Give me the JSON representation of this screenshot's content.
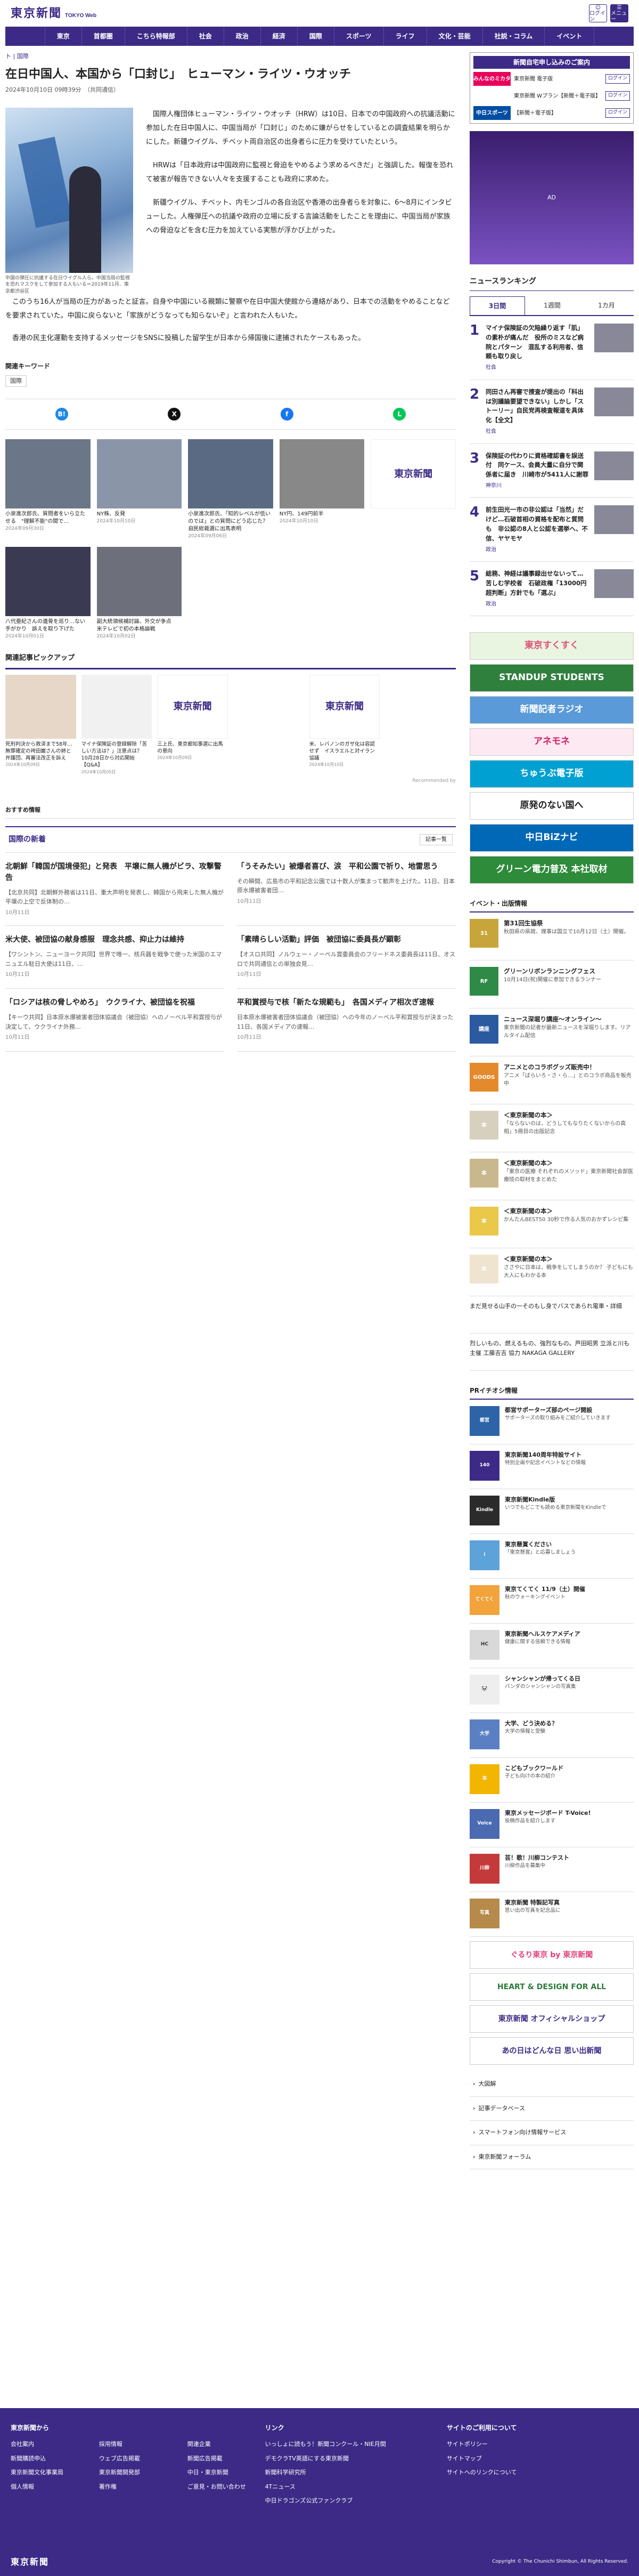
{
  "header": {
    "logo": "東京新聞",
    "logo_sub": "TOKYO Web",
    "login": "ログイン",
    "menu": "メニュー"
  },
  "nav": [
    "東京",
    "首都圏",
    "こちら特報部",
    "社会",
    "政治",
    "経済",
    "国際",
    "スポーツ",
    "ライフ",
    "文化・芸能",
    "社説・コラム",
    "イベント"
  ],
  "breadcrumb": {
    "home": "ト",
    "sep": "|",
    "section": "国際"
  },
  "article": {
    "title": "在日中国人、本国から「口封じ」　ヒューマン・ライツ・ウオッチ",
    "date": "2024年10月10日 09時39分　（共同通信）",
    "caption": "中国の弾圧に抗議する在日ウイグル人ら。中国当局の監視を恐れマスクをして参加する人もいる＝2019年11月、東京都渋谷区",
    "paragraphs": [
      "国際人権団体ヒューマン・ライツ・ウオッチ（HRW）は10日、日本での中国政府への抗議活動に参加した在日中国人に、中国当局が「口封じ」のために嫌がらせをしているとの調査結果を明らかにした。新疆ウイグル、チベット両自治区の出身者らに圧力を受けていたという。",
      "HRWは「日本政府は中国政府に監視と脅迫をやめるよう求めるべきだ」と強調した。報復を恐れて被害が報告できない人々を支援することも政府に求めた。",
      "新疆ウイグル、チベット、内モンゴルの各自治区や香港の出身者らを対象に、6〜8月にインタビューした。人権弾圧への抗議や政府の立場に反する言論活動をしたことを理由に、中国当局が家族への脅迫などを含む圧力を加えている実態が浮かび上がった。"
    ],
    "paragraphs2": [
      "このうち16人が当局の圧力があったと証言。自身や中国にいる親類に警察や在日中国大使館から連絡があり、日本での活動をやめることなどを要求されていた。中国に戻らないと「家族がどうなっても知らないぞ」と言われた人もいた。",
      "香港の民主化運動を支持するメッセージをSNSに投稿した留学生が日本から帰国後に逮捕されたケースもあった。"
    ]
  },
  "keywords": {
    "title": "関連キーワード",
    "items": [
      "国際"
    ]
  },
  "share": [
    "B!",
    "X",
    "f",
    "L"
  ],
  "related": [
    {
      "title": "小泉進次郎氏、質問者をいら立たせる　\"理解不能\"の間で…",
      "date": "2024年09月30日"
    },
    {
      "title": "NY株、反発",
      "date": "2024年10月10日"
    },
    {
      "title": "小泉進次郎氏、「知的レベルが低いのでは」との質問にどう応じた？　自民総裁選に出馬表明",
      "date": "2024年09月06日"
    },
    {
      "title": "NY円、149円前半",
      "date": "2024年10月10日"
    },
    {
      "title": "",
      "date": ""
    },
    {
      "title": "八代亜紀さんの遺骨を巡り…ない手がかり　訴えを取り下げた",
      "date": "2024年10月01日"
    },
    {
      "title": "副大統領候補討論、外交が争点　米テレビで初の本格論戦",
      "date": "2024年10月02日"
    }
  ],
  "pickup": {
    "title": "関連記事ピックアップ",
    "items": [
      {
        "title": "死刑判決から救済まで58年…無罪確定の袴田巌さんの姉と弁護団、再審法改正を訴え",
        "date": "2024年10月09日"
      },
      {
        "title": "マイナ保険証の登録解除「苦しい方法は？」注意点は？　10月28日から対応開始【Q&A】",
        "date": "2024年10月05日"
      },
      {
        "title": "三上氏、東京都知事選に出馬の意向",
        "date": "2024年10月09日"
      },
      {
        "title": "",
        "date": ""
      },
      {
        "title": "米、レバノンのガザ化は容認せず　イスラエルと対イラン協議",
        "date": "2024年10月10日"
      },
      {
        "title": "",
        "date": ""
      }
    ],
    "recommended": "Recommended by"
  },
  "osusume": "おすすめ情報",
  "latest": {
    "title": "国際の新着",
    "more": "記事一覧",
    "items": [
      {
        "title": "北朝鮮「韓国が国境侵犯」と発表　平壌に無人機がビラ、攻撃警告",
        "desc": "【北京共同】北朝鮮外務省は11日、重大声明を発表し、韓国から飛来した無人機が平壌の上空で反体制の…",
        "date": "10月11日"
      },
      {
        "title": "「うそみたい」被爆者喜び、涙　平和公園で祈り、地雷思う",
        "desc": "その瞬間、広島市の平和記念公園では十数人が集まって歓声を上げた。11日、日本原水爆被害者団…",
        "date": "10月11日"
      },
      {
        "title": "米大使、被団協の献身感服　理念共感、抑止力は維持",
        "desc": "【ワシントン、ニューヨーク共同】世界で唯一、核兵器を戦争で使った米国のエマニュエル駐日大使は11日、…",
        "date": "10月11日"
      },
      {
        "title": "「素晴らしい活動」評価　被団協に委員長が顕彰",
        "desc": "【オスロ共同】ノルウェー・ノーベル賞委員会のフリードネス委員長は11日、オスロで共同通信との単独会見…",
        "date": "10月11日"
      },
      {
        "title": "「ロシアは核の脅しやめろ」　ウクライナ、被団協を祝福",
        "desc": "【キーウ共同】日本原水爆被害者団体協議会（被団協）へのノーベル平和賞授与が決定して、ウクライナ外務…",
        "date": "10月11日"
      },
      {
        "title": "平和賞授与で核「新たな規範も」　各国メディア相次ぎ速報",
        "desc": "日本原水爆被害者団体協議会（被団協）への今年のノーベル平和賞授与が決まった11日、各国メディアの速報…",
        "date": "10月11日"
      }
    ]
  },
  "sidead": {
    "title": "新聞自宅申し込みのご案内",
    "rows": [
      {
        "logo": "みんなのミカタ",
        "text": "東京新聞 電子版",
        "btn": "ログイン"
      },
      {
        "logo": "",
        "text": "東京新聞 Wプラン【新聞＋電子版】",
        "btn": "ログイン"
      },
      {
        "logo": "中日スポーツ",
        "text": "【新聞＋電子版】",
        "btn": "ログイン"
      }
    ]
  },
  "ranking": {
    "title": "ニュースランキング",
    "tabs": [
      "3日間",
      "1週間",
      "1カ月"
    ],
    "items": [
      {
        "n": "1",
        "text": "マイナ保険証の欠陥繰り返す「肌」の素朴が痛んだ　役所のミスなど病院とパターン　混乱する利用者、信頼も取り戻し",
        "cat": "社会"
      },
      {
        "n": "2",
        "text": "同田さん再審で捜査が提出の「科出は別議論要望できない」しかし「ストーリー」自民党再検査報道を具体化【全文】",
        "cat": "社会"
      },
      {
        "n": "3",
        "text": "保険証の代わりに資格確認書を誤送付　同ケース、会員大量に自分で関係者に届き　川崎市が5411人に謝罪",
        "cat": "神奈川"
      },
      {
        "n": "4",
        "text": "前生田光一市の非公認は「当然」だけど…石破首相の資格を配布と質問も　非公認の8人と公認を選挙へ、不信、ヤヤモヤ",
        "cat": "政治"
      },
      {
        "n": "5",
        "text": "総務、神経は議事録出せないって…苦しむ学校者　石破政権「13000円超判断」方針でも「選ぶ」",
        "cat": "政治"
      }
    ]
  },
  "banners": [
    {
      "text": "東京すくすく",
      "bg": "#e9f4e1",
      "fg": "#e0517a"
    },
    {
      "text": "STANDUP STUDENTS",
      "bg": "#2f7f3d",
      "fg": "#fff"
    },
    {
      "text": "新聞記者ラジオ",
      "bg": "#5a9ad8",
      "fg": "#fff"
    },
    {
      "text": "アネモネ",
      "bg": "#fde9f1",
      "fg": "#d1206a"
    },
    {
      "text": "ちゅうぶ電子版",
      "bg": "#00a0d2",
      "fg": "#fff"
    },
    {
      "text": "原発のない国へ",
      "bg": "#fff",
      "fg": "#222"
    },
    {
      "text": "中日BiZナビ",
      "bg": "#0068b7",
      "fg": "#fff"
    },
    {
      "text": "グリーン電力普及 本社取材",
      "bg": "#2e8b3a",
      "fg": "#fff"
    }
  ],
  "events": {
    "title": "イベント・出版情報",
    "items": [
      {
        "title": "第31回生協祭",
        "desc": "秋田県の県政、理事は国立で10月12日（土）開催。",
        "bg": "#c7a53a",
        "icon": "31"
      },
      {
        "title": "グリーンリボンランニングフェス",
        "desc": "10月14日(祝)開催に参加できるランナー",
        "bg": "#2d8a47",
        "icon": "RF"
      },
      {
        "title": "ニュース深堀り講座〜オンライン〜",
        "desc": "東京新聞の記者が最新ニュースを深堀りします。リアルタイム配信",
        "bg": "#2c5aa0",
        "icon": "講座"
      },
      {
        "title": "アニメとのコラボグッズ販売中！",
        "desc": "アニメ「ばらいろ・さ・ら…」とのコラボ商品を販売中",
        "bg": "#e58a2c",
        "icon": "GOODS"
      },
      {
        "title": "＜東京新聞の本＞",
        "desc": "「ならないのは、どうしてもなりたくないからの真相」5冊目の出版記念",
        "bg": "#d8d0bf",
        "icon": "本"
      },
      {
        "title": "＜東京新聞の本＞",
        "desc": "「東京の医療 それぞれのメソッド」東京新聞社会部医療班の取材をまとめた",
        "bg": "#c9b88e",
        "icon": "本"
      },
      {
        "title": "＜東京新聞の本＞",
        "desc": "かんたんBEST50 30秒で作る人気のおかずレシピ集",
        "bg": "#e9c84a",
        "icon": "本"
      },
      {
        "title": "＜東京新聞の本＞",
        "desc": "ささやに日本は、戦争をしてしまうのか？ 子どもにも大人にもわかる本",
        "bg": "#efe4cf",
        "icon": "本"
      }
    ]
  },
  "sidelinks": [
    "まだ見せる山手の一そのもし身でバスであられ電車・詳細",
    "烈しいもの、燃えるもの、強烈なもの。芦田昭男 立派と川も 主催 工藤吉吉 協力 NAKAGA GALLERY"
  ],
  "pr": {
    "title": "PRイチオシ情報",
    "items": [
      {
        "title": "都営サポーターズ部のページ開設",
        "desc": "サポーターズの取り組みをご紹介していきます",
        "bg": "#2d64a8",
        "icon": "都営"
      },
      {
        "title": "東京新聞140周年特設サイト",
        "desc": "特別企画や記念イベントなどの情報",
        "bg": "#3c2a86",
        "icon": "140"
      },
      {
        "title": "東京新聞Kindle版",
        "desc": "いつでもどこでも読める東京新聞をKindleで",
        "bg": "#2b2b2b",
        "icon": "Kindle"
      },
      {
        "title": "東京懸賞ください",
        "desc": "「東京懸賞」と応募しましょう",
        "bg": "#5da2d8",
        "icon": "i"
      },
      {
        "title": "東京てくてく 11/9（土）開催",
        "desc": "秋のウォーキングイベント",
        "bg": "#f2a33b",
        "icon": "てくてく"
      },
      {
        "title": "東京新聞ヘルスケアメディア",
        "desc": "健康に関する信頼できる情報",
        "bg": "#d9d9d9",
        "icon": "HC"
      },
      {
        "title": "シャンシャンが帰ってくる日",
        "desc": "パンダのシャンシャンの写真集",
        "bg": "#eee",
        "icon": "🐼"
      },
      {
        "title": "大学、どう決める？",
        "desc": "大学の情報と受験",
        "bg": "#5a7fc2",
        "icon": "大学"
      },
      {
        "title": "こどもブックワールド",
        "desc": "子ども向けの本の紹介",
        "bg": "#f2b500",
        "icon": "本"
      },
      {
        "title": "東京メッセージボード T-Voice!",
        "desc": "投稿作品を紹介します",
        "bg": "#4a6ab2",
        "icon": "Voice"
      },
      {
        "title": "芸！歌！川柳コンテスト",
        "desc": "川柳作品を募集中",
        "bg": "#c43a3a",
        "icon": "川柳"
      },
      {
        "title": "東京新聞 特製記写真",
        "desc": "思い出の写真を記念品に",
        "bg": "#b58a4a",
        "icon": "写真"
      }
    ]
  },
  "banners2": [
    {
      "text": "ぐるり東京 by 東京新聞",
      "bg": "#fff",
      "fg": "#e0427a"
    },
    {
      "text": "HEART & DESIGN FOR ALL",
      "bg": "#fff",
      "fg": "#2a7a3a"
    },
    {
      "text": "東京新聞 オフィシャルショップ",
      "bg": "#fff",
      "fg": "#3c2a86"
    },
    {
      "text": "あの日はどんな日 思い出新聞",
      "bg": "#fff",
      "fg": "#3c2a86"
    }
  ],
  "accordion": [
    "大図解",
    "記事データベース",
    "スマートフォン向け情報サービス",
    "東京新聞フォーラム"
  ],
  "footer": {
    "col1_title": "東京新聞から",
    "col1": [
      "会社案内",
      "採用情報",
      "関連企業",
      "新聞購読申込",
      "ウェブ広告掲載",
      "新聞広告掲載",
      "東京新聞文化事業局",
      "東京新聞開発部",
      "中日・東京新聞",
      "個人情報",
      "著作権",
      "ご意見・お問い合わせ"
    ],
    "col2_title": "リンク",
    "col2": [
      "いっしょに読もう！新聞コンクール・NIE月間",
      "デモクラTV英語にする東京新聞",
      "新聞科学研究所",
      "4Tニュース",
      "中日ドラゴンズ公式ファンクラブ"
    ],
    "col3_title": "サイトのご利用について",
    "col3": [
      "サイトポリシー",
      "サイトマップ",
      "サイトへのリンクについて"
    ],
    "logo": "東京新聞",
    "copyright": "Copyright © The Chunichi Shimbun, All Rights Reserved."
  }
}
